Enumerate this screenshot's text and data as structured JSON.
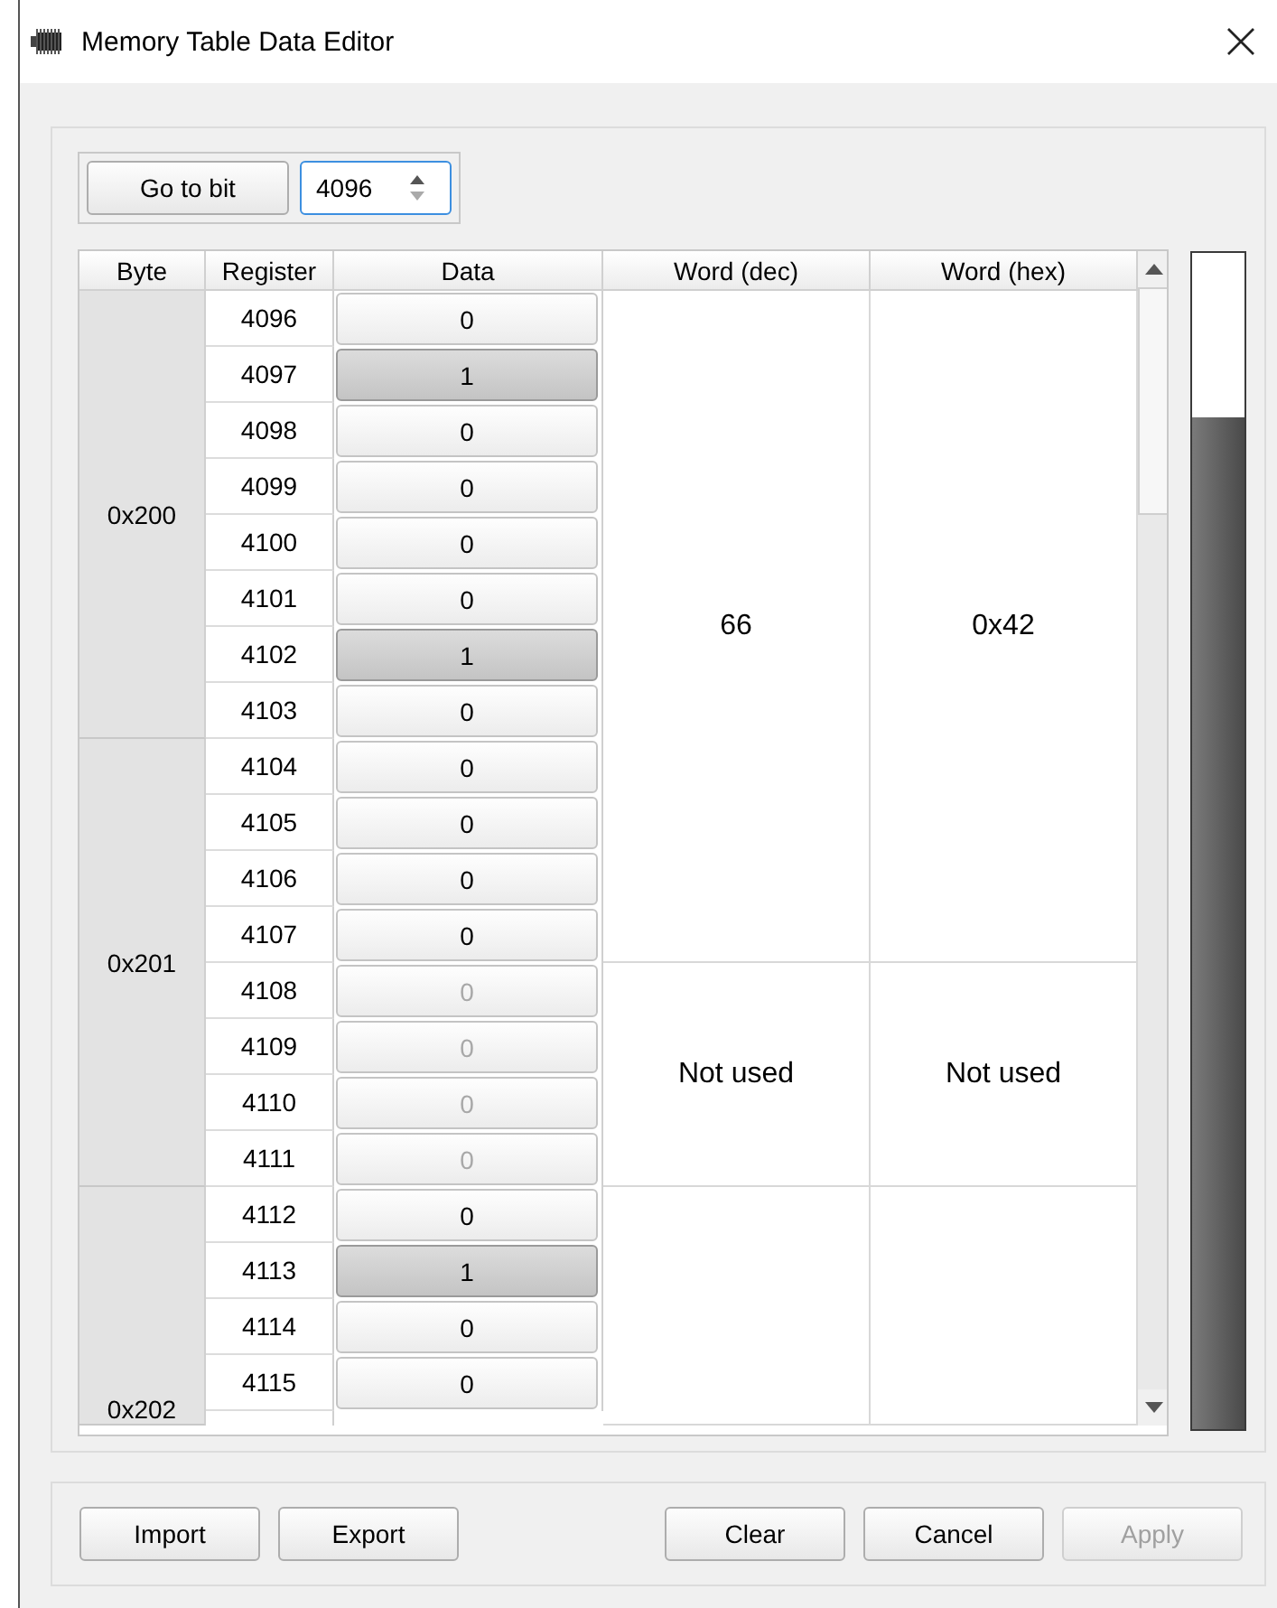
{
  "window": {
    "title": "Memory Table Data Editor"
  },
  "goto": {
    "button": "Go to bit",
    "value": "4096"
  },
  "columns": [
    "Byte",
    "Register",
    "Data",
    "Word (dec)",
    "Word (hex)"
  ],
  "bytes": [
    {
      "label": "0x200"
    },
    {
      "label": "0x201"
    },
    {
      "label": "0x202"
    }
  ],
  "words": [
    {
      "dec": "66",
      "hex": "0x42",
      "bits": [
        {
          "register": "4096",
          "value": "0",
          "on": false,
          "disabled": false
        },
        {
          "register": "4097",
          "value": "1",
          "on": true,
          "disabled": false
        },
        {
          "register": "4098",
          "value": "0",
          "on": false,
          "disabled": false
        },
        {
          "register": "4099",
          "value": "0",
          "on": false,
          "disabled": false
        },
        {
          "register": "4100",
          "value": "0",
          "on": false,
          "disabled": false
        },
        {
          "register": "4101",
          "value": "0",
          "on": false,
          "disabled": false
        },
        {
          "register": "4102",
          "value": "1",
          "on": true,
          "disabled": false
        },
        {
          "register": "4103",
          "value": "0",
          "on": false,
          "disabled": false
        },
        {
          "register": "4104",
          "value": "0",
          "on": false,
          "disabled": false
        },
        {
          "register": "4105",
          "value": "0",
          "on": false,
          "disabled": false
        },
        {
          "register": "4106",
          "value": "0",
          "on": false,
          "disabled": false
        },
        {
          "register": "4107",
          "value": "0",
          "on": false,
          "disabled": false
        }
      ]
    },
    {
      "dec": "Not used",
      "hex": "Not used",
      "bits": [
        {
          "register": "4108",
          "value": "0",
          "on": false,
          "disabled": true
        },
        {
          "register": "4109",
          "value": "0",
          "on": false,
          "disabled": true
        },
        {
          "register": "4110",
          "value": "0",
          "on": false,
          "disabled": true
        },
        {
          "register": "4111",
          "value": "0",
          "on": false,
          "disabled": true
        }
      ]
    },
    {
      "bits": [
        {
          "register": "4112",
          "value": "0",
          "on": false,
          "disabled": false
        },
        {
          "register": "4113",
          "value": "1",
          "on": true,
          "disabled": false
        },
        {
          "register": "4114",
          "value": "0",
          "on": false,
          "disabled": false
        },
        {
          "register": "4115",
          "value": "0",
          "on": false,
          "disabled": false
        }
      ]
    }
  ],
  "meter": {
    "level": 0.86
  },
  "buttons": [
    {
      "label": "Import",
      "disabled": false
    },
    {
      "label": "Export",
      "disabled": false
    },
    {
      "label": "Clear",
      "disabled": false
    },
    {
      "label": "Cancel",
      "disabled": false
    },
    {
      "label": "Apply",
      "disabled": true
    }
  ]
}
